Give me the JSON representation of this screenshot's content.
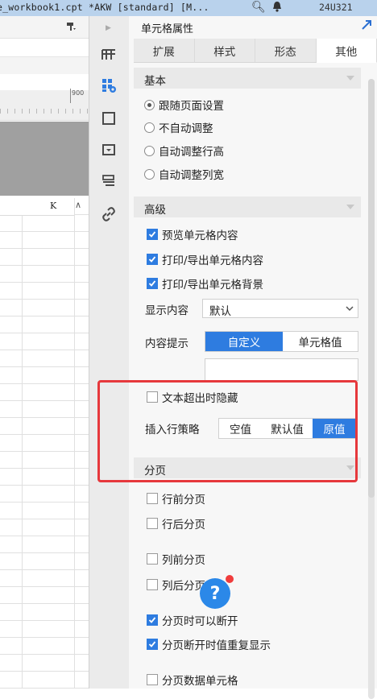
{
  "titlebar": {
    "text": "e_workbook1.cpt *AKW [standard] [M...",
    "time": "24U321"
  },
  "sheet": {
    "ruler_label": "900",
    "column_label": "K"
  },
  "iconbar": {
    "icons": [
      "cell-expand-icon",
      "cell-attributes-icon",
      "cell-border-icon",
      "cell-widget-icon",
      "condition-attributes-icon",
      "hyperlink-icon"
    ]
  },
  "panel": {
    "title": "单元格属性",
    "tabs": [
      {
        "label": "扩展",
        "active": false
      },
      {
        "label": "样式",
        "active": false
      },
      {
        "label": "形态",
        "active": false
      },
      {
        "label": "其他",
        "active": true
      }
    ],
    "basic": {
      "title": "基本",
      "options": [
        {
          "label": "跟随页面设置",
          "checked": true
        },
        {
          "label": "不自动调整",
          "checked": false
        },
        {
          "label": "自动调整行高",
          "checked": false
        },
        {
          "label": "自动调整列宽",
          "checked": false
        }
      ]
    },
    "advanced": {
      "title": "高级",
      "checks": [
        {
          "label": "预览单元格内容",
          "checked": true
        },
        {
          "label": "打印/导出单元格内容",
          "checked": true
        },
        {
          "label": "打印/导出单元格背景",
          "checked": true
        }
      ],
      "display_label": "显示内容",
      "display_value": "默认",
      "hint_label": "内容提示",
      "hint_options": [
        {
          "label": "自定义",
          "active": true
        },
        {
          "label": "单元格值",
          "active": false
        }
      ],
      "hide_overflow_label": "文本超出时隐藏",
      "hide_overflow_checked": false,
      "insert_label": "插入行策略",
      "insert_options": [
        {
          "label": "空值",
          "active": false
        },
        {
          "label": "默认值",
          "active": false
        },
        {
          "label": "原值",
          "active": true
        }
      ]
    },
    "pagination": {
      "title": "分页",
      "checks": [
        {
          "label": "行前分页",
          "checked": false
        },
        {
          "label": "行后分页",
          "checked": false
        },
        {
          "label": "列前分页",
          "checked": false
        },
        {
          "label": "列后分页",
          "checked": false
        },
        {
          "label": "分页时可以断开",
          "checked": true
        },
        {
          "label": "分页断开时值重复显示",
          "checked": true
        },
        {
          "label": "分页数据单元格",
          "checked": false
        }
      ]
    },
    "help_glyph": "?"
  },
  "colors": {
    "accent": "#2e7ce0",
    "highlight_border": "#e6383c",
    "titlebar_bg": "#b9d2ec"
  }
}
